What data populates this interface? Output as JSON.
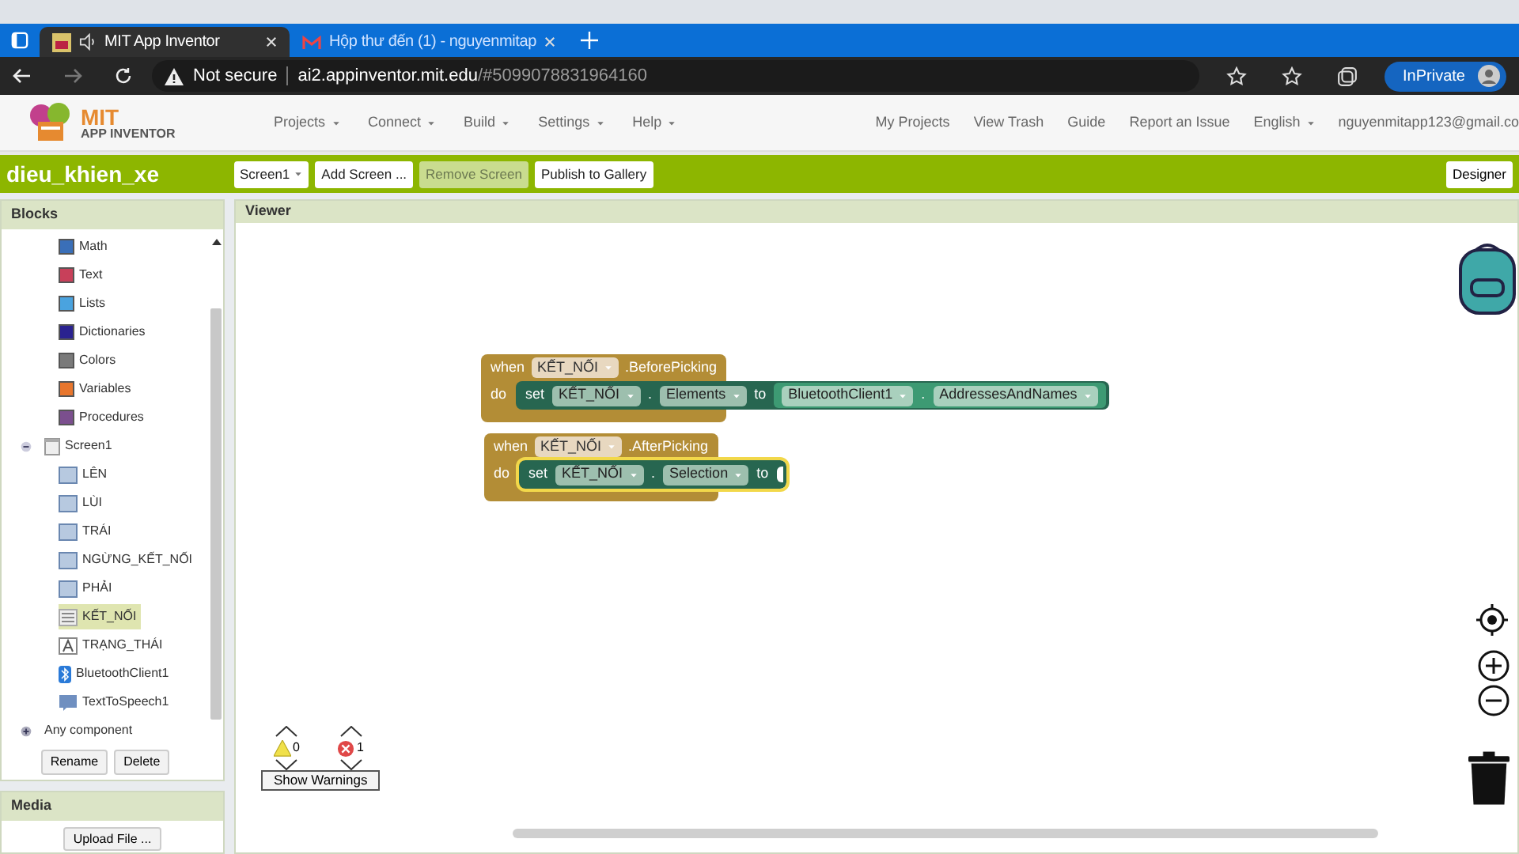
{
  "browser": {
    "tabs": [
      {
        "title": "MIT App Inventor",
        "kind": "app",
        "selected": true
      },
      {
        "title": "Hộp thư đến (1) - nguyenmitap",
        "kind": "mail",
        "selected": false
      }
    ],
    "address": {
      "security": "Not secure",
      "host": "ai2.appinventor.mit.edu",
      "path": "/#5099078831964160"
    },
    "inprivate": "InPrivate"
  },
  "header": {
    "logo": {
      "line1": "MIT",
      "line2": "APP INVENTOR"
    },
    "menus": [
      {
        "label": "Projects",
        "kind": "menu"
      },
      {
        "label": "Connect",
        "kind": "menu"
      },
      {
        "label": "Build",
        "kind": "menu"
      },
      {
        "label": "Settings",
        "kind": "menu"
      },
      {
        "label": "Help",
        "kind": "menu"
      }
    ],
    "links": [
      {
        "label": "My Projects",
        "kind": "link"
      },
      {
        "label": "View Trash",
        "kind": "link"
      },
      {
        "label": "Guide",
        "kind": "link"
      },
      {
        "label": "Report an Issue",
        "kind": "link"
      },
      {
        "label": "English",
        "kind": "menu"
      },
      {
        "label": "nguyenmitapp123@gmail.co",
        "kind": "link"
      }
    ]
  },
  "project_bar": {
    "name": "dieu_khien_xe",
    "buttons": [
      {
        "label": "Screen1",
        "kind": "menu",
        "disabled": false
      },
      {
        "label": "Add Screen ...",
        "kind": "button",
        "disabled": false
      },
      {
        "label": "Remove Screen",
        "kind": "button",
        "disabled": true
      },
      {
        "label": "Publish to Gallery",
        "kind": "button",
        "disabled": false
      }
    ],
    "right_buttons": [
      {
        "label": "Designer"
      }
    ]
  },
  "blocks_panel": {
    "title": "Blocks",
    "builtin": [
      {
        "label": "Math",
        "color": "#3a6fb8"
      },
      {
        "label": "Text",
        "color": "#c8405a"
      },
      {
        "label": "Lists",
        "color": "#4aa3df"
      },
      {
        "label": "Dictionaries",
        "color": "#2a2290"
      },
      {
        "label": "Colors",
        "color": "#7a7a7a"
      },
      {
        "label": "Variables",
        "color": "#e8762d"
      },
      {
        "label": "Procedures",
        "color": "#7b4f8e"
      }
    ],
    "tree": [
      {
        "label": "Screen1",
        "kind": "screen",
        "expanded": true,
        "selected": false,
        "children": [
          {
            "label": "LÊN",
            "kind": "button",
            "selected": false
          },
          {
            "label": "LÙI",
            "kind": "button",
            "selected": false
          },
          {
            "label": "TRÁI",
            "kind": "button",
            "selected": false
          },
          {
            "label": "NGỪNG_KẾT_NỐI",
            "kind": "button",
            "selected": false
          },
          {
            "label": "PHẢI",
            "kind": "button",
            "selected": false
          },
          {
            "label": "KẾT_NỐI",
            "kind": "listpicker",
            "selected": true
          },
          {
            "label": "TRẠNG_THÁI",
            "kind": "label",
            "selected": false
          },
          {
            "label": "BluetoothClient1",
            "kind": "bluetooth",
            "selected": false
          },
          {
            "label": "TextToSpeech1",
            "kind": "speech",
            "selected": false
          }
        ]
      },
      {
        "label": "Any component",
        "kind": "any",
        "expanded": false,
        "selected": false
      }
    ],
    "buttons": [
      "Rename",
      "Delete"
    ]
  },
  "media_panel": {
    "title": "Media",
    "button": "Upload File ..."
  },
  "viewer": {
    "title": "Viewer",
    "events": [
      {
        "when": "when",
        "component": "KẾT_NỐI",
        "event": ".BeforePicking",
        "do": "do",
        "statement": {
          "set": "set",
          "component": "KẾT_NỐI",
          "dot": ".",
          "property": "Elements",
          "to": "to",
          "selected": false,
          "value": {
            "component": "BluetoothClient1",
            "dot": ".",
            "property": "AddressesAndNames"
          }
        }
      },
      {
        "when": "when",
        "component": "KẾT_NỐI",
        "event": ".AfterPicking",
        "do": "do",
        "statement": {
          "set": "set",
          "component": "KẾT_NỐI",
          "dot": ".",
          "property": "Selection",
          "to": "to",
          "selected": true
        }
      }
    ],
    "warnings": {
      "warning_count": "0",
      "error_count": "1",
      "button": "Show Warnings"
    }
  }
}
